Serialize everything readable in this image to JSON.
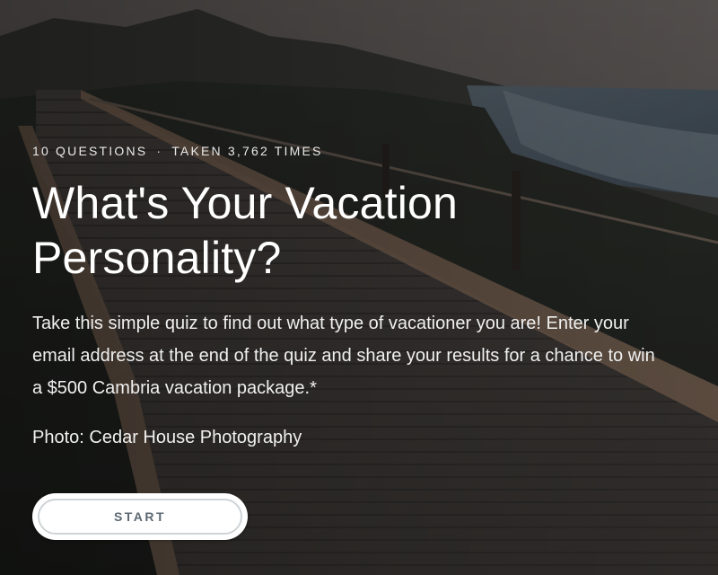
{
  "quiz": {
    "question_count": "10 QUESTIONS",
    "separator": "·",
    "taken_count": "TAKEN 3,762 TIMES",
    "title": "What's Your Vacation Personality?",
    "description": "Take this simple quiz to find out what type of vacationer you are! Enter your email address at the end of the quiz and share your results for a chance to win a $500 Cambria vacation package.*",
    "photo_credit": "Photo: Cedar House Photography",
    "start_label": "START"
  },
  "colors": {
    "button_bg": "#ffffff",
    "button_text": "#5c6872",
    "button_ring": "#cfd3d6"
  }
}
